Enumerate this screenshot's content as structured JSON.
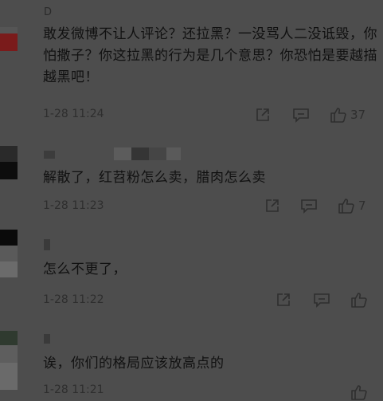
{
  "comments": [
    {
      "username": "D",
      "text": "敢发微博不让人评论？还拉黑？一没骂人二没诋毁，你怕撒子？你这拉黑的行为是几个意思？你恐怕是要越描越黑吧！",
      "time": "1-28 11:24",
      "likes": "37"
    },
    {
      "username": "",
      "text": "解散了，红苕粉怎么卖，腊肉怎么卖",
      "time": "1-28 11:23",
      "likes": "7"
    },
    {
      "username": "",
      "text": "怎么不更了，",
      "time": "1-28 11:22",
      "likes": ""
    },
    {
      "username": "",
      "text": "诶，你们的格局应该放高点的",
      "time": "1-28 11:21",
      "likes": ""
    }
  ],
  "icons": {
    "share": "share-icon",
    "comment": "comment-icon",
    "like": "thumbs-up-icon"
  },
  "colors": {
    "background": "#4d4d4d",
    "text": "#111111",
    "meta": "#2e2e2e"
  }
}
